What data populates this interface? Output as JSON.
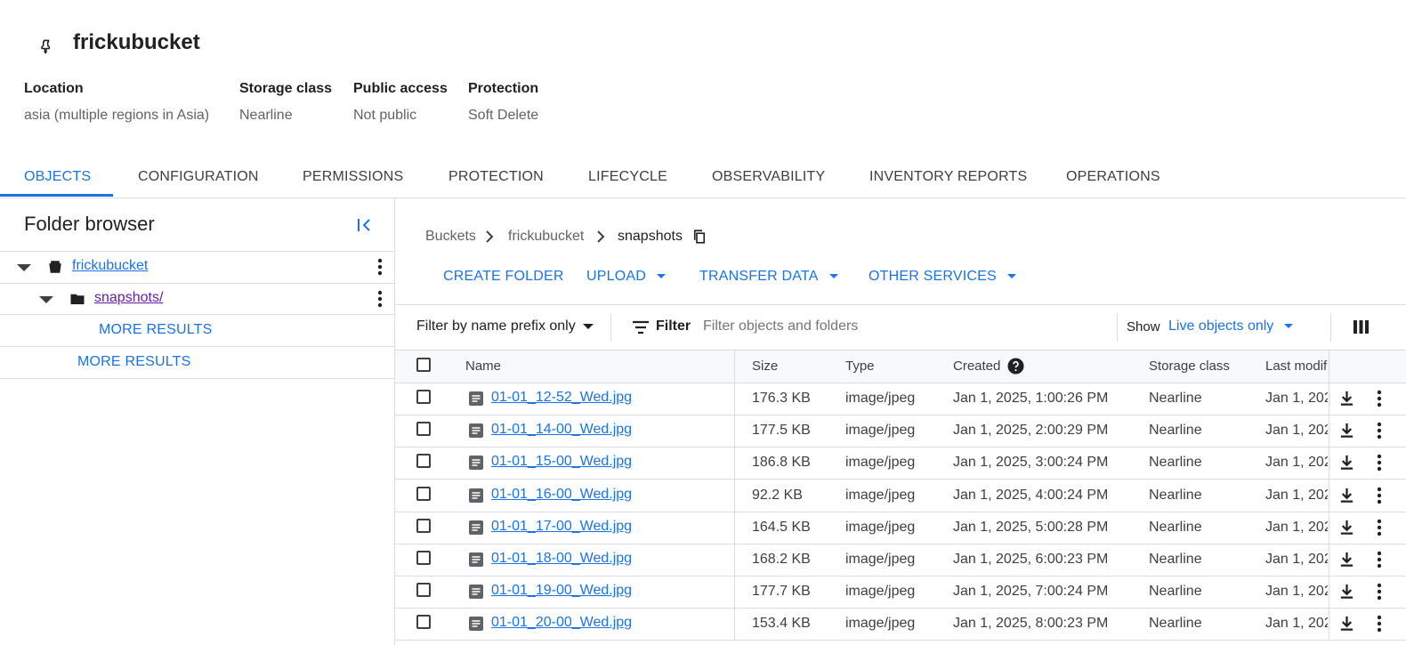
{
  "bucket": {
    "name": "frickubucket"
  },
  "meta": [
    {
      "label": "Location",
      "value": "asia (multiple regions in Asia)"
    },
    {
      "label": "Storage class",
      "value": "Nearline"
    },
    {
      "label": "Public access",
      "value": "Not public"
    },
    {
      "label": "Protection",
      "value": "Soft Delete"
    }
  ],
  "tabs": [
    "OBJECTS",
    "CONFIGURATION",
    "PERMISSIONS",
    "PROTECTION",
    "LIFECYCLE",
    "OBSERVABILITY",
    "INVENTORY REPORTS",
    "OPERATIONS"
  ],
  "active_tab": "OBJECTS",
  "folder_browser": {
    "title": "Folder browser",
    "bucket_item": "frickubucket",
    "folder_item": "snapshots/",
    "more_results_inner": "MORE RESULTS",
    "more_results_outer": "MORE RESULTS"
  },
  "breadcrumb": {
    "root": "Buckets",
    "bucket": "frickubucket",
    "folder": "snapshots"
  },
  "actions": {
    "create_folder": "CREATE FOLDER",
    "upload": "UPLOAD",
    "transfer_data": "TRANSFER DATA",
    "other_services": "OTHER SERVICES"
  },
  "filter": {
    "mode": "Filter by name prefix only",
    "label": "Filter",
    "placeholder": "Filter objects and folders",
    "show_label": "Show",
    "show_value": "Live objects only"
  },
  "table": {
    "headers": {
      "name": "Name",
      "size": "Size",
      "type": "Type",
      "created": "Created",
      "storage": "Storage class",
      "modified": "Last modif"
    },
    "rows": [
      {
        "name": "01-01_12-52_Wed.jpg",
        "size": "176.3 KB",
        "type": "image/jpeg",
        "created": "Jan 1, 2025, 1:00:26 PM",
        "storage": "Nearline",
        "modified": "Jan 1, 202"
      },
      {
        "name": "01-01_14-00_Wed.jpg",
        "size": "177.5 KB",
        "type": "image/jpeg",
        "created": "Jan 1, 2025, 2:00:29 PM",
        "storage": "Nearline",
        "modified": "Jan 1, 202"
      },
      {
        "name": "01-01_15-00_Wed.jpg",
        "size": "186.8 KB",
        "type": "image/jpeg",
        "created": "Jan 1, 2025, 3:00:24 PM",
        "storage": "Nearline",
        "modified": "Jan 1, 202"
      },
      {
        "name": "01-01_16-00_Wed.jpg",
        "size": "92.2 KB",
        "type": "image/jpeg",
        "created": "Jan 1, 2025, 4:00:24 PM",
        "storage": "Nearline",
        "modified": "Jan 1, 202"
      },
      {
        "name": "01-01_17-00_Wed.jpg",
        "size": "164.5 KB",
        "type": "image/jpeg",
        "created": "Jan 1, 2025, 5:00:28 PM",
        "storage": "Nearline",
        "modified": "Jan 1, 202"
      },
      {
        "name": "01-01_18-00_Wed.jpg",
        "size": "168.2 KB",
        "type": "image/jpeg",
        "created": "Jan 1, 2025, 6:00:23 PM",
        "storage": "Nearline",
        "modified": "Jan 1, 202"
      },
      {
        "name": "01-01_19-00_Wed.jpg",
        "size": "177.7 KB",
        "type": "image/jpeg",
        "created": "Jan 1, 2025, 7:00:24 PM",
        "storage": "Nearline",
        "modified": "Jan 1, 202"
      },
      {
        "name": "01-01_20-00_Wed.jpg",
        "size": "153.4 KB",
        "type": "image/jpeg",
        "created": "Jan 1, 2025, 8:00:23 PM",
        "storage": "Nearline",
        "modified": "Jan 1, 202"
      }
    ]
  },
  "colors": {
    "accent": "#1a73e8",
    "visited_link": "#681da8",
    "border": "#dadce0",
    "text": "#202124",
    "muted": "#5f6368"
  },
  "icons": [
    "pin-icon",
    "collapse-panel-icon",
    "bucket-icon",
    "folder-icon",
    "kebab-icon",
    "chevron-right-icon",
    "copy-icon",
    "filter-icon",
    "help-icon",
    "column-display-icon",
    "file-icon",
    "download-icon",
    "dropdown-arrow-icon"
  ]
}
